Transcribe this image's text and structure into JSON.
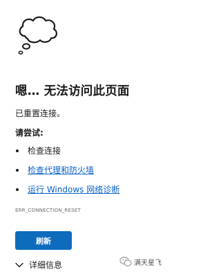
{
  "error_page": {
    "icon": "thought-cloud-icon",
    "title": "嗯… 无法访问此页面",
    "subtitle": "已重置连接。",
    "try_heading": "请尝试:",
    "suggestions": [
      {
        "text": "检查连接",
        "is_link": false
      },
      {
        "text": "检查代理和防火墙",
        "is_link": true
      },
      {
        "text": "运行 Windows 网络诊断",
        "is_link": true
      }
    ],
    "error_code": "ERR_CONNECTION_RESET",
    "refresh_label": "刷新",
    "details_label": "详细信息",
    "details_icon": "chevron-down-icon"
  },
  "watermark": {
    "icon": "wechat-icon",
    "text": "满天星飞"
  },
  "colors": {
    "accent": "#0f6cbd",
    "link": "#0a62c6",
    "text": "#1b1b1b",
    "muted": "#6b6b6b"
  }
}
